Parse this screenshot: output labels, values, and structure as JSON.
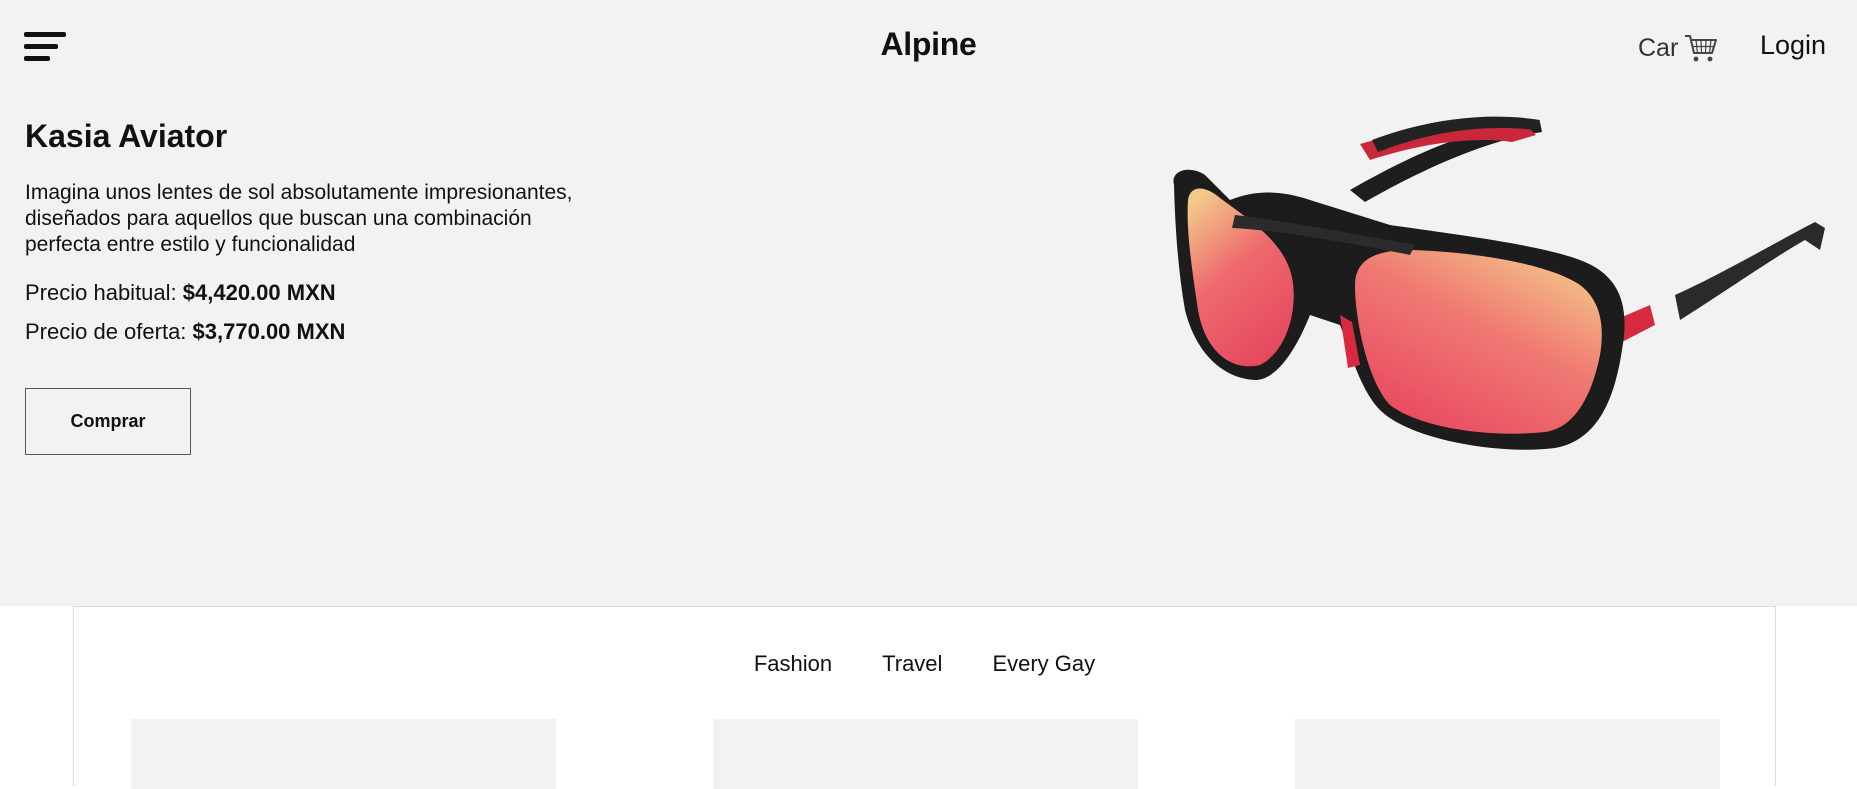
{
  "header": {
    "menu_icon": "hamburger-menu-icon",
    "brand": "Alpine",
    "cart_label": "Car",
    "cart_icon": "shopping-cart-icon",
    "login_label": "Login"
  },
  "product": {
    "title": "Kasia Aviator",
    "description": "Imagina unos lentes de sol absolutamente impresionantes, diseñados para aquellos que buscan una combinación perfecta entre estilo y funcionalidad",
    "regular_price_label": "Precio habitual: ",
    "regular_price": "$4,420.00 MXN",
    "sale_price_label": "Precio de oferta: ",
    "sale_price": "$3,770.00 MXN",
    "buy_label": "Comprar",
    "image": "aviator-sunglasses-image",
    "colors": {
      "frame": "#1c1c1c",
      "accent": "#e0283c",
      "lens_top": "#f6d58f",
      "lens_bottom": "#e94a62"
    }
  },
  "tabs": [
    {
      "label": "Fashion"
    },
    {
      "label": "Travel"
    },
    {
      "label": "Every Gay"
    }
  ],
  "cards": [
    {
      "name": "card"
    },
    {
      "name": "card"
    },
    {
      "name": "card"
    }
  ],
  "colors": {
    "hero_bg": "#f2f2f2",
    "page_bg": "#ffffff",
    "text": "#111111"
  }
}
